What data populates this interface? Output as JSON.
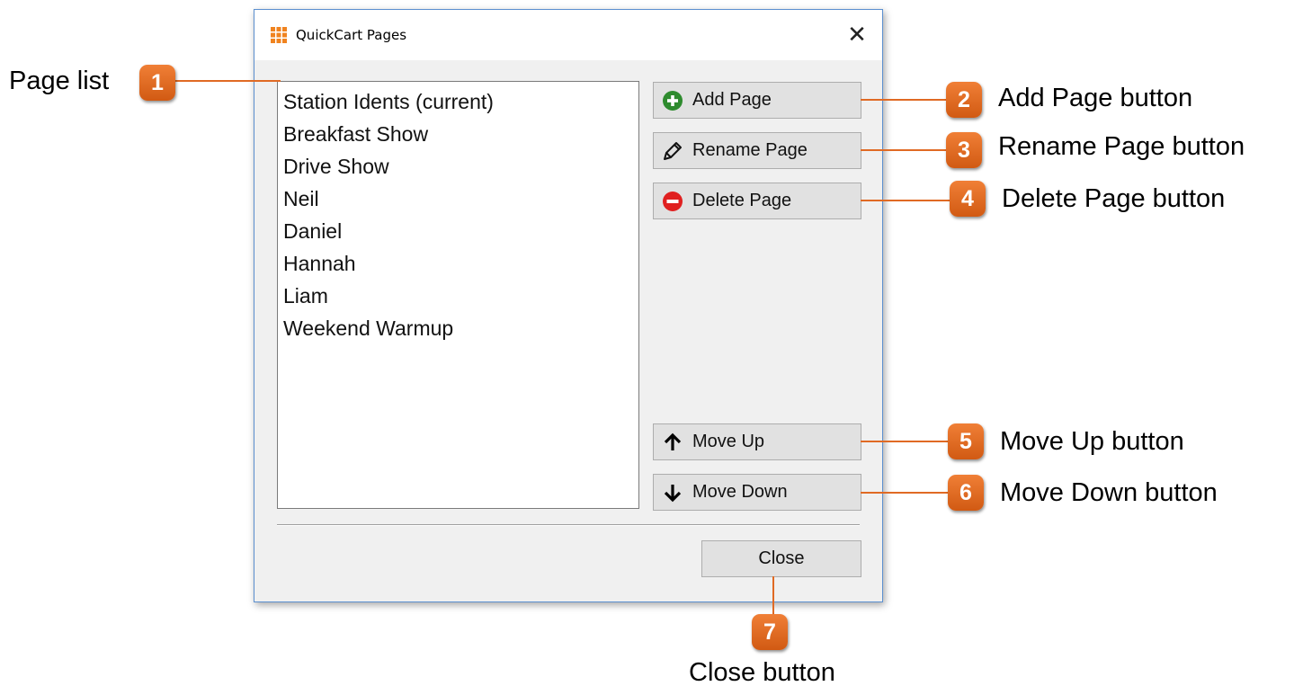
{
  "window": {
    "title": "QuickCart Pages",
    "close_glyph": "✕"
  },
  "pages": [
    "Station Idents (current)",
    "Breakfast Show",
    "Drive Show",
    "Neil",
    "Daniel",
    "Hannah",
    "Liam",
    "Weekend Warmup"
  ],
  "buttons": {
    "add": "Add Page",
    "rename": "Rename Page",
    "delete": "Delete Page",
    "move_up": "Move Up",
    "move_down": "Move Down",
    "close": "Close"
  },
  "callouts": [
    {
      "number": "1",
      "label": "Page list"
    },
    {
      "number": "2",
      "label": "Add Page button"
    },
    {
      "number": "3",
      "label": "Rename Page button"
    },
    {
      "number": "4",
      "label": "Delete Page button"
    },
    {
      "number": "5",
      "label": "Move Up button"
    },
    {
      "number": "6",
      "label": "Move Down button"
    },
    {
      "number": "7",
      "label": "Close button"
    }
  ],
  "colors": {
    "badge": "#e56e25",
    "leader": "#e06a24",
    "window_border": "#5b8fcf",
    "add_icon": "#2e8b2e",
    "delete_icon": "#e02020"
  }
}
